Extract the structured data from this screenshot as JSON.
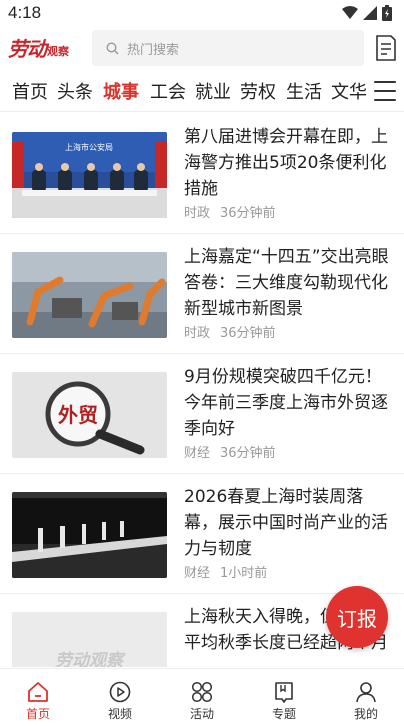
{
  "status": {
    "time": "4:18"
  },
  "header": {
    "logo_main": "劳动",
    "logo_sub": "观察",
    "search_placeholder": "热门搜索"
  },
  "tabs": [
    {
      "label": "首页",
      "active": false
    },
    {
      "label": "头条",
      "active": false
    },
    {
      "label": "城事",
      "active": true
    },
    {
      "label": "工会",
      "active": false
    },
    {
      "label": "就业",
      "active": false
    },
    {
      "label": "劳权",
      "active": false
    },
    {
      "label": "生活",
      "active": false
    },
    {
      "label": "文华",
      "active": false
    }
  ],
  "news": [
    {
      "title": "第八届进博会开幕在即，上海警方推出5项20条便利化措施",
      "category": "时政",
      "time": "36分钟前",
      "thumb_text": "上海市公安局",
      "thumb_icon": "press-conference-photo"
    },
    {
      "title": "上海嘉定“十四五”交出亮眼答卷：三大维度勾勒现代化新型城市新图景",
      "category": "时政",
      "time": "36分钟前",
      "thumb_icon": "robot-factory-photo"
    },
    {
      "title": "9月份规模突破四千亿元！今年前三季度上海市外贸逐季向好",
      "category": "财经",
      "time": "36分钟前",
      "thumb_text": "外贸",
      "thumb_icon": "magnifier-photo"
    },
    {
      "title": "2026春夏上海时装周落幕，展示中国时尚产业的活力与韧度",
      "category": "财经",
      "time": "1小时前",
      "thumb_icon": "fashion-runway-photo"
    },
    {
      "title": "上海秋天入得晚，但不短！平均秋季长度已经超两个月",
      "category": "",
      "time": "",
      "thumb_text": "劳动观察",
      "thumb_icon": "placeholder-logo"
    }
  ],
  "fab": {
    "label": "订报"
  },
  "bottom_nav": [
    {
      "label": "首页",
      "icon": "home-icon",
      "active": true
    },
    {
      "label": "视频",
      "icon": "play-icon",
      "active": false
    },
    {
      "label": "活动",
      "icon": "grid-icon",
      "active": false
    },
    {
      "label": "专题",
      "icon": "bookmark-icon",
      "active": false
    },
    {
      "label": "我的",
      "icon": "user-icon",
      "active": false
    }
  ],
  "colors": {
    "accent": "#d9342b",
    "fab": "#e0332f",
    "logo": "#c8242b"
  }
}
